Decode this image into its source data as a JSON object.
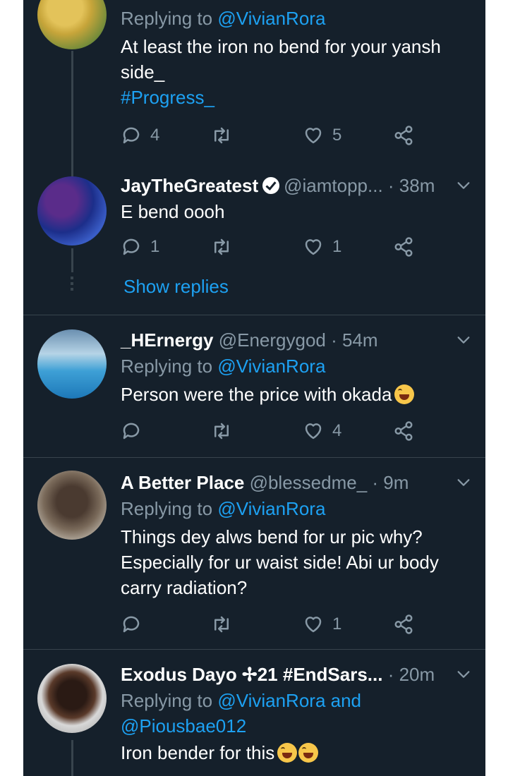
{
  "tweets": [
    {
      "reply_to_prefix": "Replying to ",
      "reply_to_handle": "@VivianRora",
      "body_lines": [
        "At least the iron no bend for your yansh",
        "side_"
      ],
      "hashtag": "#Progress_",
      "counts": {
        "reply": "4",
        "retweet": "",
        "like": "5"
      }
    },
    {
      "name": "JayTheGreatest",
      "handle": "@iamtopp...",
      "time": "· 38m",
      "body": "E bend oooh",
      "counts": {
        "reply": "1",
        "retweet": "",
        "like": "1"
      },
      "show_replies": "Show replies"
    },
    {
      "name": "_HErnergy",
      "handle": "@Energygod",
      "time": "· 54m",
      "reply_to_prefix": "Replying to ",
      "reply_to_handle": "@VivianRora",
      "body": "Person were the price with  okada",
      "counts": {
        "reply": "",
        "retweet": "",
        "like": "4"
      }
    },
    {
      "name": "A Better Place",
      "handle": "@blessedme_",
      "time": "· 9m",
      "reply_to_prefix": "Replying to ",
      "reply_to_handle": "@VivianRora",
      "body_lines": [
        "Things dey alws bend for ur pic why?",
        "Especially for ur waist side! Abi ur body",
        "carry radiation?"
      ],
      "counts": {
        "reply": "",
        "retweet": "",
        "like": "1"
      }
    },
    {
      "name": "Exodus Dayo ✢21 #EndSars...",
      "time": "· 20m",
      "reply_to_prefix": "Replying to ",
      "reply_to_handle": "@VivianRora",
      "reply_to_and": " and",
      "reply_to_handle2": "@Piousbae012",
      "body": "Iron bender for this"
    }
  ],
  "colors": {
    "background": "#15202b",
    "text": "#ffffff",
    "muted": "#8899a6",
    "link": "#1da1f2",
    "divider": "#38444d"
  },
  "icons": [
    "reply-icon",
    "retweet-icon",
    "like-icon",
    "share-icon",
    "chevron-down-icon",
    "verified-icon",
    "laughing-emoji-icon"
  ]
}
